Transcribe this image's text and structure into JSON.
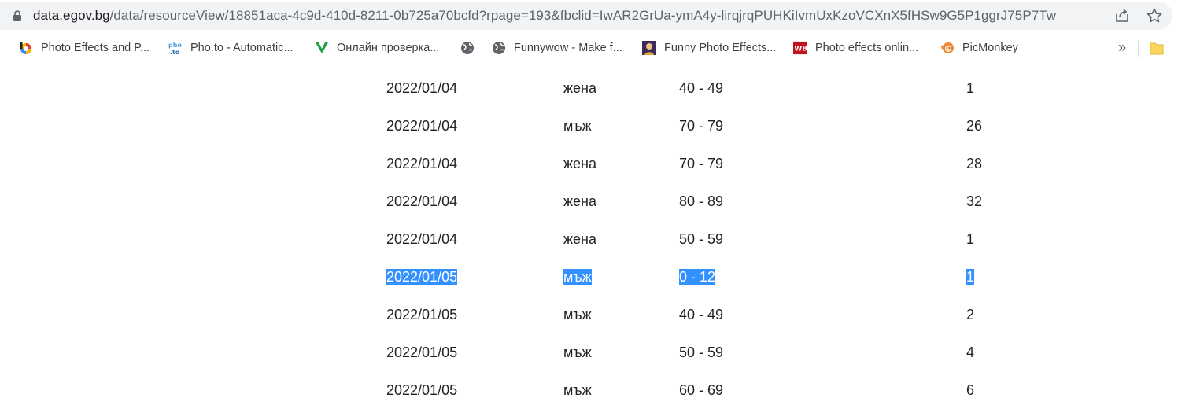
{
  "browser": {
    "url_host": "data.egov.bg",
    "url_path": "/data/resourceView/18851aca-4c9d-410d-8211-0b725a70bcfd?rpage=193&fbclid=IwAR2GrUa-ymA4y-lirqjrqPUHKiIvmUxKzoVCXnX5fHSw9G5P1ggrJ75P7Tw",
    "bookmarks": [
      {
        "label": "Photo Effects and P...",
        "icon": "colorful-circle-icon"
      },
      {
        "label": "Pho.to - Automatic...",
        "icon": "photo-logo-icon"
      },
      {
        "label": "Онлайн проверка...",
        "icon": "green-v-icon"
      },
      {
        "label": "",
        "icon": "globe-icon"
      },
      {
        "label": "Funnywow - Make f...",
        "icon": "globe-icon"
      },
      {
        "label": "Funny Photo Effects...",
        "icon": "photo-thumb-icon"
      },
      {
        "label": "Photo effects onlin...",
        "icon": "wb-logo-icon"
      },
      {
        "label": "PicMonkey",
        "icon": "picmonkey-icon"
      }
    ],
    "more_label": "»"
  },
  "table": {
    "rows": [
      {
        "date": "2022/01/04",
        "sex": "жена",
        "age": "40 - 49",
        "count": "1",
        "selected": false
      },
      {
        "date": "2022/01/04",
        "sex": "мъж",
        "age": "70 - 79",
        "count": "26",
        "selected": false
      },
      {
        "date": "2022/01/04",
        "sex": "жена",
        "age": "70 - 79",
        "count": "28",
        "selected": false
      },
      {
        "date": "2022/01/04",
        "sex": "жена",
        "age": "80 - 89",
        "count": "32",
        "selected": false
      },
      {
        "date": "2022/01/04",
        "sex": "жена",
        "age": "50 - 59",
        "count": "1",
        "selected": false
      },
      {
        "date": "2022/01/05",
        "sex": "мъж",
        "age": "0 - 12",
        "count": "1",
        "selected": true
      },
      {
        "date": "2022/01/05",
        "sex": "мъж",
        "age": "40 - 49",
        "count": "2",
        "selected": false
      },
      {
        "date": "2022/01/05",
        "sex": "мъж",
        "age": "50 - 59",
        "count": "4",
        "selected": false
      },
      {
        "date": "2022/01/05",
        "sex": "мъж",
        "age": "60 - 69",
        "count": "6",
        "selected": false
      }
    ]
  },
  "colors": {
    "selection": "#3390ff",
    "text": "#222222"
  }
}
